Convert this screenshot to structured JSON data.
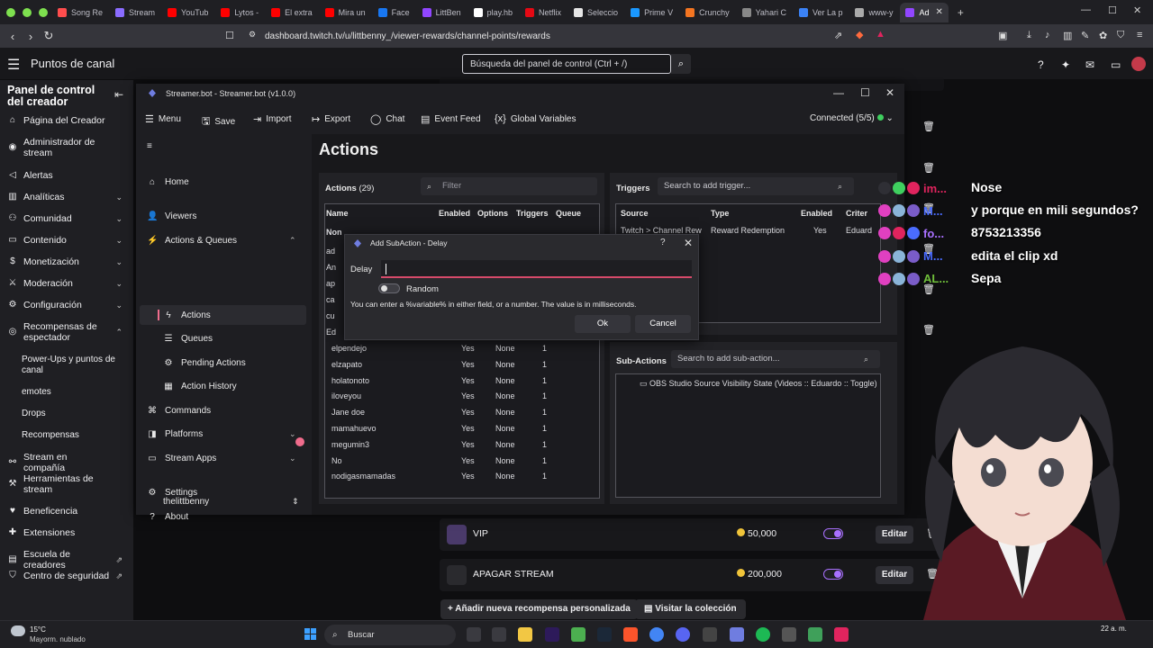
{
  "browser": {
    "tabs": [
      {
        "label": "Song Re",
        "color": "#ff4d4d"
      },
      {
        "label": "Stream",
        "color": "#8a6cff"
      },
      {
        "label": "YouTub",
        "color": "#ff0000"
      },
      {
        "label": "Lytos -",
        "color": "#ff0000"
      },
      {
        "label": "El extra",
        "color": "#ff0000"
      },
      {
        "label": "Mira un",
        "color": "#ff0000"
      },
      {
        "label": "Face",
        "color": "#1877f2"
      },
      {
        "label": "LittBen",
        "color": "#9146ff"
      },
      {
        "label": "play.hb",
        "color": "#ffffff"
      },
      {
        "label": "Netflix",
        "color": "#e50914"
      },
      {
        "label": "Seleccio",
        "color": "#e6e6e6"
      },
      {
        "label": "Prime V",
        "color": "#1a98ff"
      },
      {
        "label": "Crunchy",
        "color": "#f47521"
      },
      {
        "label": "Yahari C",
        "color": "#888888"
      },
      {
        "label": "Ver La p",
        "color": "#3b82f6"
      },
      {
        "label": "www-y",
        "color": "#aaaaaa"
      },
      {
        "label": "Ad",
        "color": "#9146ff"
      }
    ],
    "url": "dashboard.twitch.tv/u/littbenny_/viewer-rewards/channel-points/rewards"
  },
  "twitch": {
    "page_title": "Puntos de canal",
    "search_placeholder": "Búsqueda del panel de control (Ctrl + /)",
    "sidebar": {
      "title": "Panel de control del creador",
      "items": [
        {
          "label": "Página del Creador",
          "icon": "home-icon"
        },
        {
          "label": "Administrador de stream",
          "icon": "broadcast-icon"
        },
        {
          "label": "Alertas",
          "icon": "megaphone-icon"
        },
        {
          "label": "Analíticas",
          "icon": "chart-icon"
        },
        {
          "label": "Comunidad",
          "icon": "people-icon"
        },
        {
          "label": "Contenido",
          "icon": "video-icon"
        },
        {
          "label": "Monetización",
          "icon": "dollar-icon"
        },
        {
          "label": "Moderación",
          "icon": "sword-icon"
        },
        {
          "label": "Configuración",
          "icon": "gear-icon"
        },
        {
          "label": "Recompensas de espectador",
          "icon": "gift-icon"
        }
      ],
      "subitems": [
        "Power-Ups y puntos de canal",
        "emotes",
        "Drops",
        "Recompensas"
      ],
      "items2": [
        {
          "label": "Stream en compañía",
          "icon": "link-icon"
        },
        {
          "label": "Herramientas de stream",
          "icon": "tools-icon"
        },
        {
          "label": "Beneficencia",
          "icon": "heart-icon"
        },
        {
          "label": "Extensiones",
          "icon": "puzzle-icon"
        },
        {
          "label": "Escuela de creadores",
          "icon": "book-icon"
        },
        {
          "label": "Centro de seguridad",
          "icon": "shield-icon"
        }
      ]
    },
    "rewards": [
      {
        "name": "VIP",
        "cost": "50,000",
        "edit": "Editar"
      },
      {
        "name": "APAGAR STREAM",
        "cost": "200,000",
        "edit": "Editar"
      }
    ],
    "add_reward": "Añadir nueva recompensa personalizada",
    "visit_collection": "Visitar la colección"
  },
  "streamerbot": {
    "window_title": "Streamer.bot - Streamer.bot (v1.0.0)",
    "menu": {
      "menu": "Menu",
      "save": "Save",
      "import": "Import",
      "export": "Export",
      "chat": "Chat",
      "event_feed": "Event Feed",
      "global_vars": "Global Variables"
    },
    "connected": "Connected (5/5)",
    "nav": {
      "home": "Home",
      "viewers": "Viewers",
      "actions_queues": "Actions & Queues",
      "actions": "Actions",
      "queues": "Queues",
      "pending": "Pending Actions",
      "history": "Action History",
      "commands": "Commands",
      "platforms": "Platforms",
      "stream_apps": "Stream Apps",
      "settings": "Settings",
      "about": "About",
      "user": "thelittbenny"
    },
    "heading": "Actions",
    "actions_pane": {
      "label": "Actions",
      "count": "(29)",
      "filter": "Filter",
      "columns": [
        "Name",
        "Enabled",
        "Options",
        "Triggers",
        "Queue"
      ],
      "partial_names": [
        "Non",
        "ad",
        "An",
        "ap",
        "ca",
        "cu",
        "Ed"
      ],
      "rows": [
        {
          "name": "elpendejo",
          "enabled": "Yes",
          "queue": "None",
          "triggers": "1"
        },
        {
          "name": "elzapato",
          "enabled": "Yes",
          "queue": "None",
          "triggers": "1"
        },
        {
          "name": "holatonoto",
          "enabled": "Yes",
          "queue": "None",
          "triggers": "1"
        },
        {
          "name": "iloveyou",
          "enabled": "Yes",
          "queue": "None",
          "triggers": "1"
        },
        {
          "name": "Jane doe",
          "enabled": "Yes",
          "queue": "None",
          "triggers": "1"
        },
        {
          "name": "mamahuevo",
          "enabled": "Yes",
          "queue": "None",
          "triggers": "1"
        },
        {
          "name": "megumin3",
          "enabled": "Yes",
          "queue": "None",
          "triggers": "1"
        },
        {
          "name": "No",
          "enabled": "Yes",
          "queue": "None",
          "triggers": "1"
        },
        {
          "name": "nodigasmamadas",
          "enabled": "Yes",
          "queue": "None",
          "triggers": "1"
        }
      ]
    },
    "triggers_pane": {
      "label": "Triggers",
      "search": "Search to add trigger...",
      "columns": [
        "Source",
        "Type",
        "Enabled",
        "Criter"
      ],
      "row": {
        "source": "Twitch > Channel Rew",
        "type": "Reward Redemption",
        "enabled": "Yes",
        "criteria": "Eduard"
      }
    },
    "subactions_pane": {
      "label": "Sub-Actions",
      "search": "Search to add sub-action...",
      "item": "OBS Studio Source Visibility State (Videos :: Eduardo :: Toggle)"
    }
  },
  "dialog": {
    "title": "Add SubAction - Delay",
    "help": "?",
    "delay_label": "Delay",
    "delay_value": "",
    "random_label": "Random",
    "random_on": false,
    "help_text": "You can enter a %variable% in either field, or a number.  The value is in milliseconds.",
    "ok": "Ok",
    "cancel": "Cancel"
  },
  "chat": [
    {
      "user": "im...",
      "user_color": "#e0245e",
      "message": "Nose"
    },
    {
      "user": "M...",
      "user_color": "#4a6cff",
      "message": "y porque en mili segundos?"
    },
    {
      "user": "fo...",
      "user_color": "#a970ff",
      "message": "8753213356"
    },
    {
      "user": "M...",
      "user_color": "#4a6cff",
      "message": "edita el clip xd"
    },
    {
      "user": "AL...",
      "user_color": "#6fbf3a",
      "message": "Sepa"
    }
  ],
  "taskbar": {
    "temperature": "15°C",
    "weather": "Mayorm. nublado",
    "search": "Buscar",
    "clock": "22 a. m."
  }
}
